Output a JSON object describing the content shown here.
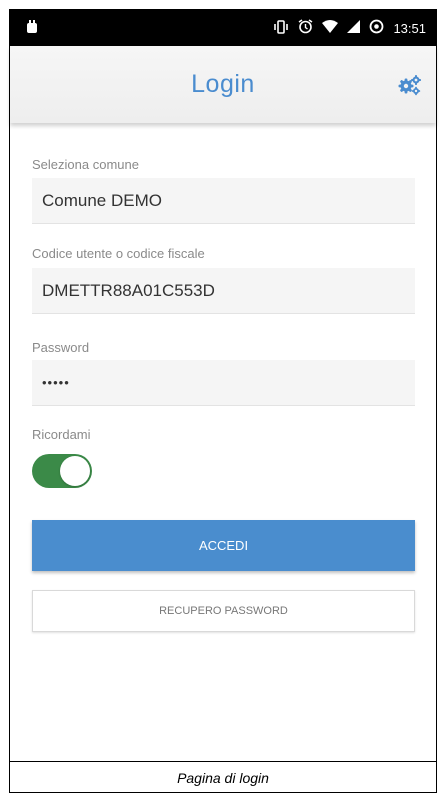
{
  "status_bar": {
    "time": "13:51",
    "icons": [
      "notification-icon",
      "vibrate-icon",
      "alarm-icon",
      "wifi-icon",
      "signal-icon",
      "sync-icon"
    ]
  },
  "header": {
    "title": "Login",
    "settings_icon": "gears-icon"
  },
  "form": {
    "comune_label": "Seleziona comune",
    "comune_value": "Comune DEMO",
    "user_label": "Codice utente o codice fiscale",
    "user_value": "DMETTR88A01C553D",
    "password_label": "Password",
    "password_value": "•••••",
    "remember_label": "Ricordami",
    "remember_on": true
  },
  "actions": {
    "login_label": "ACCEDI",
    "recover_label": "RECUPERO PASSWORD"
  },
  "caption": "Pagina di login",
  "colors": {
    "accent": "#4a8dce",
    "toggle_on": "#3b8a48",
    "status_bar": "#000000"
  }
}
